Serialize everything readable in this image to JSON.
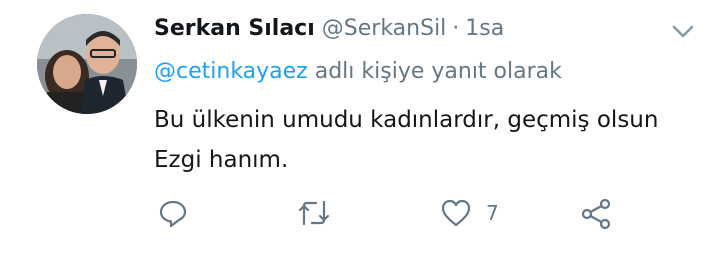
{
  "tweet": {
    "author_name": "Serkan Sılacı",
    "author_handle": "@SerkanSil",
    "separator": "·",
    "time": "1sa",
    "reply_mention": "@cetinkayaez",
    "reply_suffix": "adlı kişiye yanıt olarak",
    "text": "Bu ülkenin umudu kadınlardır, geçmiş olsun Ezgi hanım."
  },
  "actions": {
    "reply_icon": "reply-icon",
    "retweet_icon": "retweet-icon",
    "like_icon": "heart-icon",
    "like_count": "7",
    "share_icon": "share-icon"
  },
  "colors": {
    "text": "#14171a",
    "secondary": "#657786",
    "link": "#1da1f2"
  }
}
